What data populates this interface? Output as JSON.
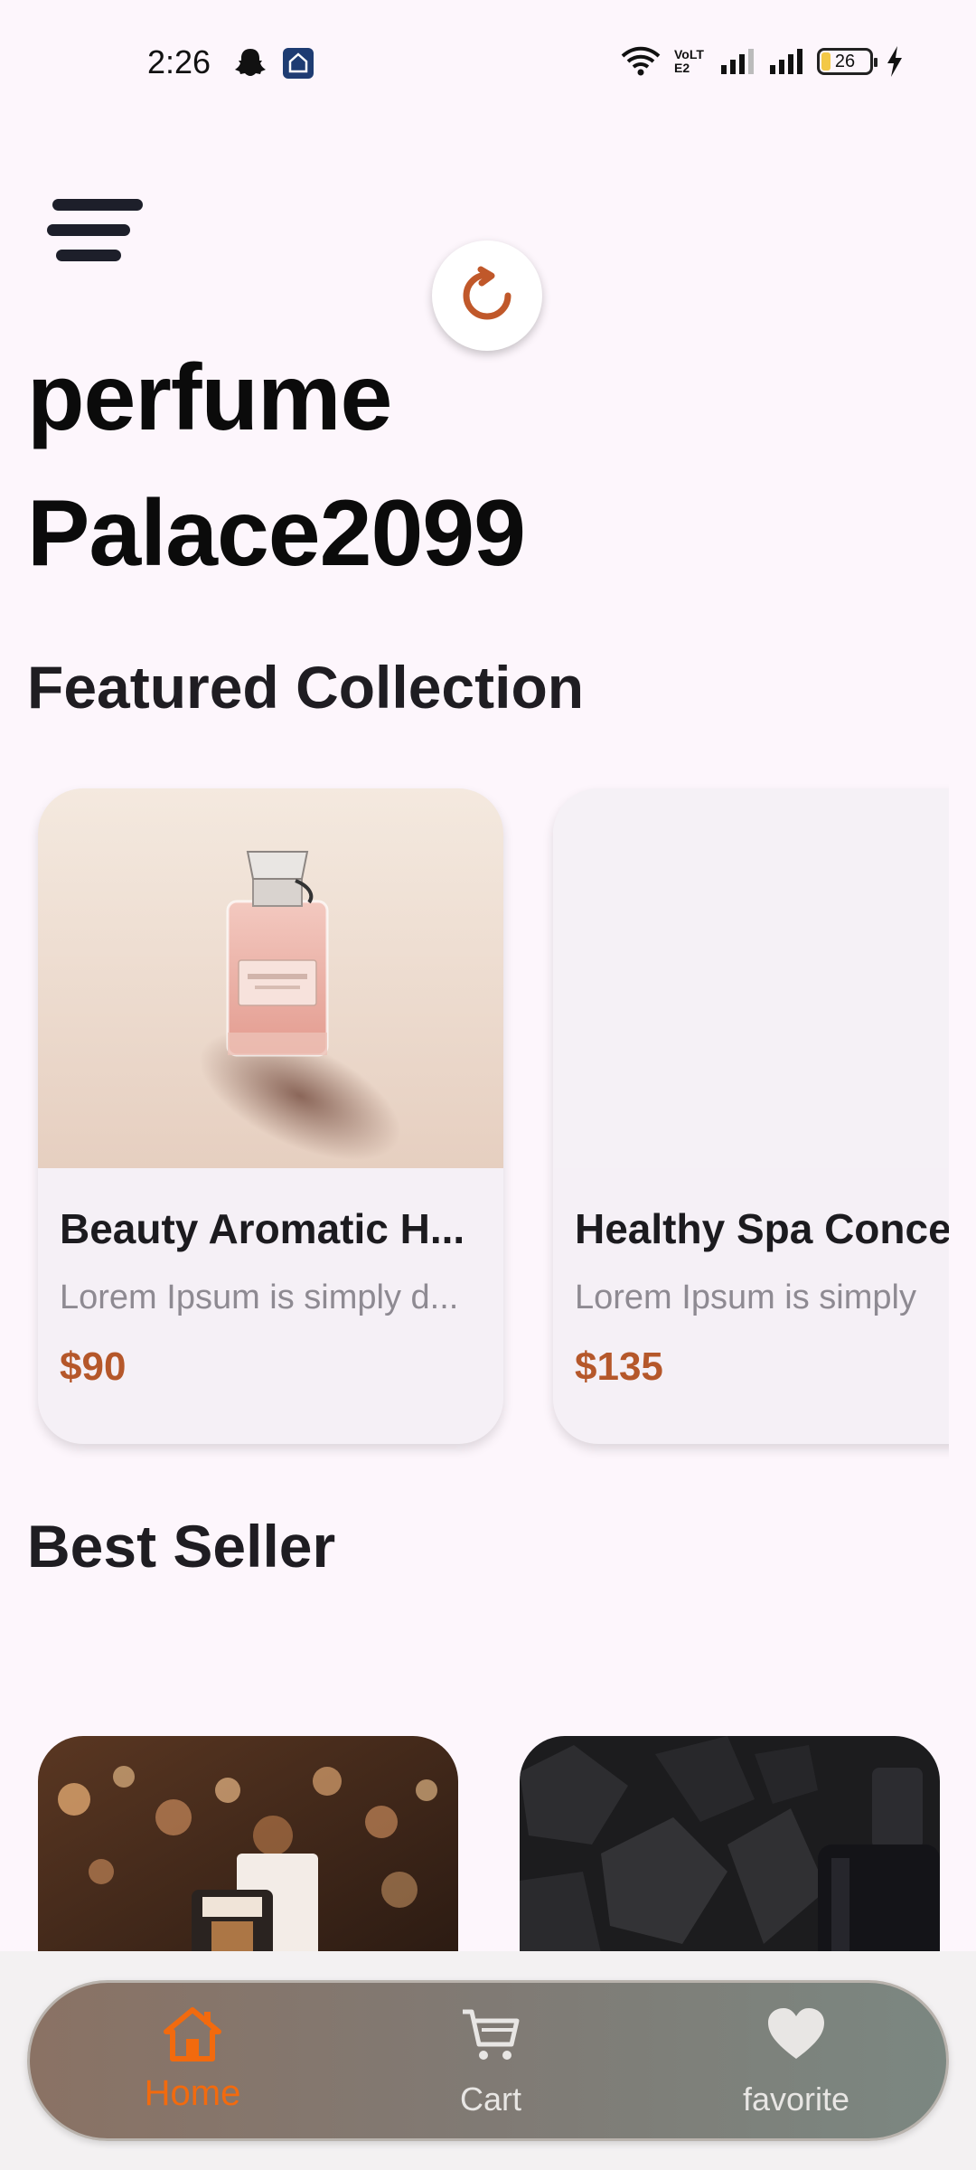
{
  "status_bar": {
    "time": "2:26",
    "network_label": "VoLTE2",
    "battery": "26",
    "icons": [
      "snapchat-icon",
      "app-icon",
      "wifi-icon",
      "volte-icon",
      "signal-icon",
      "signal-icon",
      "battery-icon",
      "charging-icon"
    ]
  },
  "header": {
    "menu_icon": "menu-icon",
    "refresh_icon": "refresh-icon",
    "title_line1": "perfume",
    "title_line2": "Palace2099"
  },
  "featured": {
    "title": "Featured Collection",
    "items": [
      {
        "name": "Beauty Aromatic H...",
        "description": "Lorem Ipsum is simply d...",
        "price": "$90"
      },
      {
        "name": "Healthy Spa Conce",
        "description": "Lorem Ipsum is simply",
        "price": "$135"
      }
    ]
  },
  "best_seller": {
    "title": "Best Seller"
  },
  "bottom_nav": {
    "items": [
      {
        "label": "Home",
        "icon": "home-icon",
        "active": true
      },
      {
        "label": "Cart",
        "icon": "cart-icon",
        "active": false
      },
      {
        "label": "favorite",
        "icon": "heart-icon",
        "active": false
      }
    ],
    "active_color": "#f26a0e"
  },
  "colors": {
    "background": "#fdf6fc",
    "price": "#b5572a",
    "accent": "#f26a0e"
  }
}
